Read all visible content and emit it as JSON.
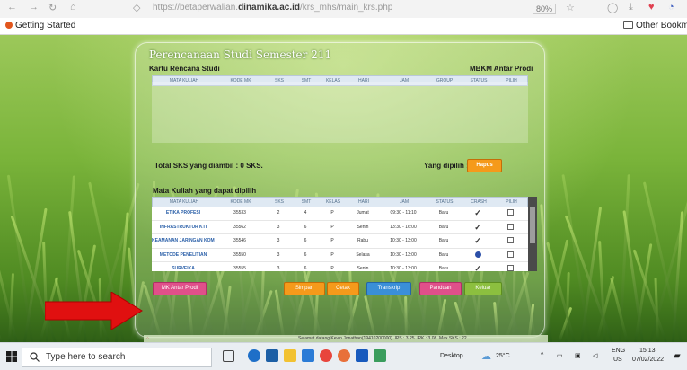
{
  "browser": {
    "url_prefix": "https://betaperwalian.",
    "url_domain": "dinamika.ac.id",
    "url_path": "/krs_mhs/main_krs.php",
    "zoom": "80%",
    "bookmarks": {
      "getting_started": "Getting Started",
      "other": "Other Bookmarks"
    }
  },
  "page": {
    "title": "Perencanaan Studi Semester 211",
    "krs_label": "Kartu Rencana Studi",
    "mbkm_label": "MBKM Antar Prodi",
    "krs_headers": [
      "MATA KULIAH",
      "KODE MK",
      "SKS",
      "SMT",
      "KELAS",
      "HARI",
      "JAM",
      "GROUP",
      "STATUS",
      "PILIH"
    ],
    "total_label": "Total SKS yang diambil : 0 SKS.",
    "yang_dipilih_label": "Yang dipilih :",
    "hapus_label": "Hapus",
    "available_label": "Mata Kuliah yang dapat dipilih",
    "avail_headers": [
      "MATA KULIAH",
      "KODE MK",
      "SKS",
      "SMT",
      "KELAS",
      "HARI",
      "JAM",
      "STATUS",
      "CRASH",
      "PILIH"
    ],
    "rows": [
      [
        "ETIKA PROFESI",
        "35533",
        "2",
        "4",
        "P",
        "Jumat",
        "09:30 - 11:10",
        "Baru",
        "check",
        "box"
      ],
      [
        "INFRASTRUKTUR KTI",
        "35562",
        "3",
        "6",
        "P",
        "Senin",
        "13:30 - 16:00",
        "Baru",
        "check",
        "box"
      ],
      [
        "KEAMANAN JARINGAN KOMPUTER",
        "35546",
        "3",
        "6",
        "P",
        "Rabu",
        "10:30 - 13:00",
        "Baru",
        "check",
        "box"
      ],
      [
        "METODE PENELITIAN",
        "35550",
        "3",
        "6",
        "P",
        "Selasa",
        "10:30 - 13:00",
        "Baru",
        "ban",
        "box"
      ],
      [
        "SURVEIKA",
        "35555",
        "3",
        "6",
        "P",
        "Senin",
        "10:30 - 13:00",
        "Baru",
        "check",
        "box"
      ]
    ],
    "buttons": {
      "mk_antar_prodi": "MK Antar Prodi",
      "simpan": "Simpan",
      "cetak": "Cetak",
      "transkrip": "Transkrip",
      "panduan": "Panduan",
      "keluar": "Keluar"
    },
    "footer": "Selamat datang Kevin Jonathan(19410200000). IPS : 3.25. IPK : 3.08. Max SKS : 22."
  },
  "taskbar": {
    "search_placeholder": "Type here to search",
    "desktop": "Desktop",
    "temp": "25°C",
    "lang": "ENG",
    "region": "US",
    "time": "15:13",
    "date": "07/02/2022"
  },
  "colors": {
    "orange_button": "#f59a1b",
    "blue_button": "#3a8fd8",
    "pink_button": "#e0508a",
    "green_button": "#8cbf3f",
    "red_arrow": "#e01010"
  }
}
